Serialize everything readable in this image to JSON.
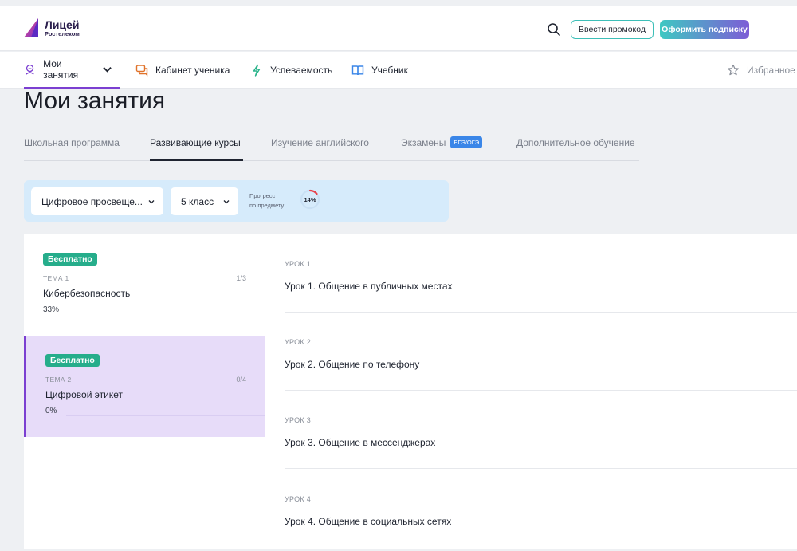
{
  "header": {
    "logo_title": "Лицей",
    "logo_subtitle": "Ростелеком",
    "promo_button": "Ввести промокод",
    "subscribe_button": "Оформить подписку"
  },
  "nav": {
    "items": [
      {
        "label": "Мои занятия",
        "icon": "student-icon"
      },
      {
        "label": "Кабинет ученика",
        "icon": "chat-icon"
      },
      {
        "label": "Успеваемость",
        "icon": "lightning-icon"
      },
      {
        "label": "Учебник",
        "icon": "book-icon"
      }
    ],
    "favorites": "Избранное"
  },
  "page": {
    "title": "Мои занятия"
  },
  "tabs": [
    {
      "label": "Школьная программа"
    },
    {
      "label": "Развивающие курсы"
    },
    {
      "label": "Изучение английского"
    },
    {
      "label": "Экзамены",
      "badge": "ЕГЭ/ОГЭ"
    },
    {
      "label": "Дополнительное обучение"
    }
  ],
  "filter": {
    "subject": "Цифровое просвеще...",
    "grade": "5 класс",
    "progress_label_1": "Прогресс",
    "progress_label_2": "по предмету",
    "progress_value": "14%",
    "progress_fraction": 0.14
  },
  "topics": [
    {
      "badge": "Бесплатно",
      "num": "ТЕМА 1",
      "count": "1/3",
      "title": "Кибербезопасность",
      "percent": "33%"
    },
    {
      "badge": "Бесплатно",
      "num": "ТЕМА 2",
      "count": "0/4",
      "title": "Цифровой этикет",
      "percent": "0%"
    }
  ],
  "lessons": [
    {
      "num": "УРОК 1",
      "title": "Урок 1. Общение в публичных местах"
    },
    {
      "num": "УРОК 2",
      "title": "Урок 2. Общение по телефону"
    },
    {
      "num": "УРОК 3",
      "title": "Урок 3. Общение в мессенджерах"
    },
    {
      "num": "УРОК 4",
      "title": "Урок 4. Общение в социальных сетях"
    }
  ],
  "colors": {
    "accent": "#7b3fd1",
    "teal": "#3dbfb8",
    "free_badge": "#26ad8b",
    "exam_badge": "#3a86e8"
  }
}
